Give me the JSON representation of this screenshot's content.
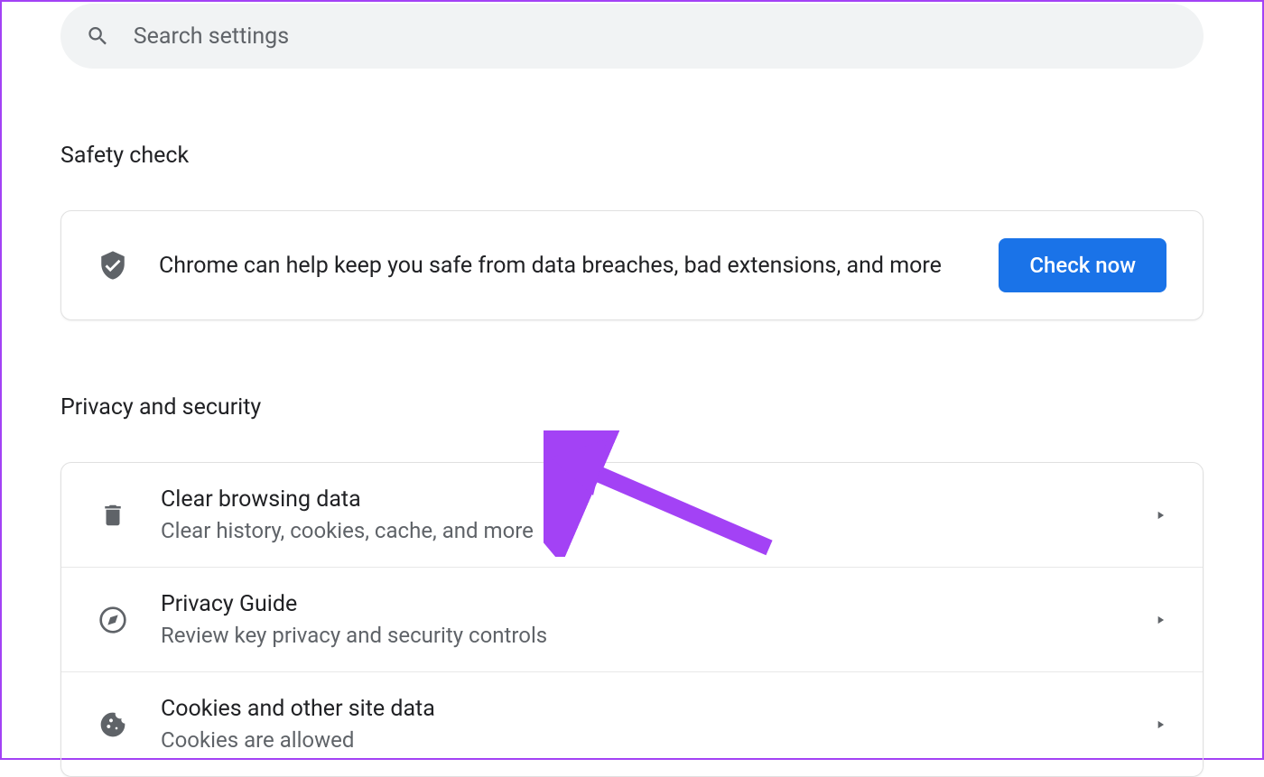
{
  "search": {
    "placeholder": "Search settings"
  },
  "sections": {
    "safety_check": {
      "title": "Safety check",
      "description": "Chrome can help keep you safe from data breaches, bad extensions, and more",
      "button_label": "Check now"
    },
    "privacy_security": {
      "title": "Privacy and security",
      "items": [
        {
          "title": "Clear browsing data",
          "subtitle": "Clear history, cookies, cache, and more"
        },
        {
          "title": "Privacy Guide",
          "subtitle": "Review key privacy and security controls"
        },
        {
          "title": "Cookies and other site data",
          "subtitle": "Cookies are allowed"
        }
      ]
    }
  },
  "colors": {
    "accent": "#1a73e8",
    "annotation": "#a342f5"
  }
}
